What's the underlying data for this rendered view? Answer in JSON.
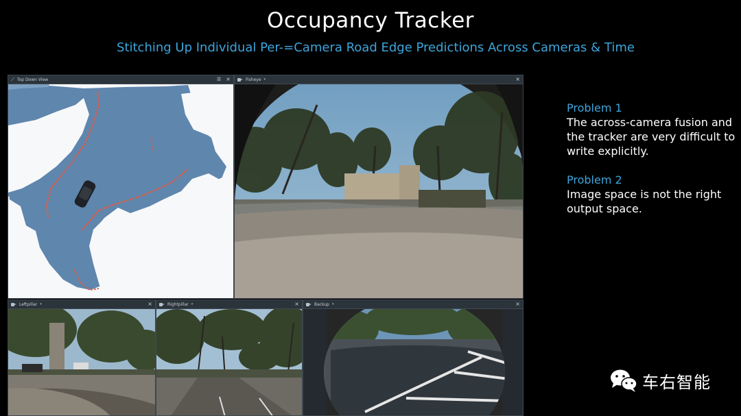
{
  "title": "Occupancy Tracker",
  "subtitle": "Stitching Up Individual Per-=Camera Road Edge Predictions Across Cameras & Time",
  "panels": {
    "top_down": {
      "label": "Top Down View",
      "close": "×",
      "menu": "☰"
    },
    "fisheye": {
      "label": "Fisheye",
      "caret": "▾",
      "close": "×"
    },
    "left_pillar": {
      "label": "Leftpillar",
      "caret": "▾",
      "close": "×"
    },
    "right_pillar": {
      "label": "Rightpillar",
      "caret": "▾",
      "close": "×"
    },
    "backup": {
      "label": "Backup",
      "caret": "▾",
      "close": "×"
    }
  },
  "problems": [
    {
      "title": "Problem 1",
      "text": "The across-camera fusion and the tracker are very difficult to write explicitly."
    },
    {
      "title": "Problem 2",
      "text": "Image space is not the right output space."
    }
  ],
  "watermark": {
    "text": "车右智能",
    "icon": "wechat-icon"
  },
  "colors": {
    "accent": "#3ca6dc",
    "drivable": "#5f86ad",
    "road_edge": "#d7604f"
  }
}
